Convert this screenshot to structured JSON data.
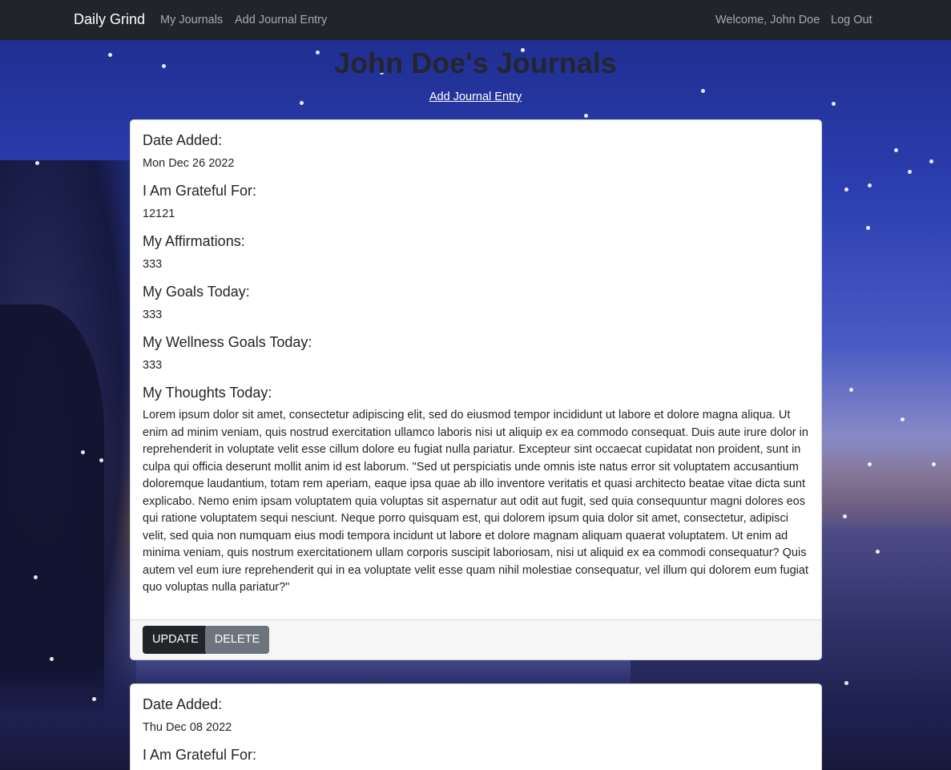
{
  "navbar": {
    "brand": "Daily Grind",
    "links": [
      "My Journals",
      "Add Journal Entry"
    ],
    "welcome": "Welcome, John Doe",
    "logout": "Log Out"
  },
  "page": {
    "title": "John Doe's Journals",
    "add_link": "Add Journal Entry"
  },
  "labels": {
    "date": "Date Added:",
    "grateful": "I Am Grateful For:",
    "affirmations": "My Affirmations:",
    "goals": "My Goals Today:",
    "wellness": "My Wellness Goals Today:",
    "thoughts": "My Thoughts Today:"
  },
  "entries": [
    {
      "date": "Mon Dec 26 2022",
      "grateful": "12121",
      "affirmations": "333",
      "goals": "333",
      "wellness": "333",
      "thoughts": "Lorem ipsum dolor sit amet, consectetur adipiscing elit, sed do eiusmod tempor incididunt ut labore et dolore magna aliqua. Ut enim ad minim veniam, quis nostrud exercitation ullamco laboris nisi ut aliquip ex ea commodo consequat. Duis aute irure dolor in reprehenderit in voluptate velit esse cillum dolore eu fugiat nulla pariatur. Excepteur sint occaecat cupidatat non proident, sunt in culpa qui officia deserunt mollit anim id est laborum. \"Sed ut perspiciatis unde omnis iste natus error sit voluptatem accusantium doloremque laudantium, totam rem aperiam, eaque ipsa quae ab illo inventore veritatis et quasi architecto beatae vitae dicta sunt explicabo. Nemo enim ipsam voluptatem quia voluptas sit aspernatur aut odit aut fugit, sed quia consequuntur magni dolores eos qui ratione voluptatem sequi nesciunt. Neque porro quisquam est, qui dolorem ipsum quia dolor sit amet, consectetur, adipisci velit, sed quia non numquam eius modi tempora incidunt ut labore et dolore magnam aliquam quaerat voluptatem. Ut enim ad minima veniam, quis nostrum exercitationem ullam corporis suscipit laboriosam, nisi ut aliquid ex ea commodi consequatur? Quis autem vel eum iure reprehenderit qui in ea voluptate velit esse quam nihil molestiae consequatur, vel illum qui dolorem eum fugiat quo voluptas nulla pariatur?\"",
      "update_label": "UPDATE",
      "delete_label": "DELETE"
    },
    {
      "date": "Thu Dec 08 2022"
    }
  ]
}
